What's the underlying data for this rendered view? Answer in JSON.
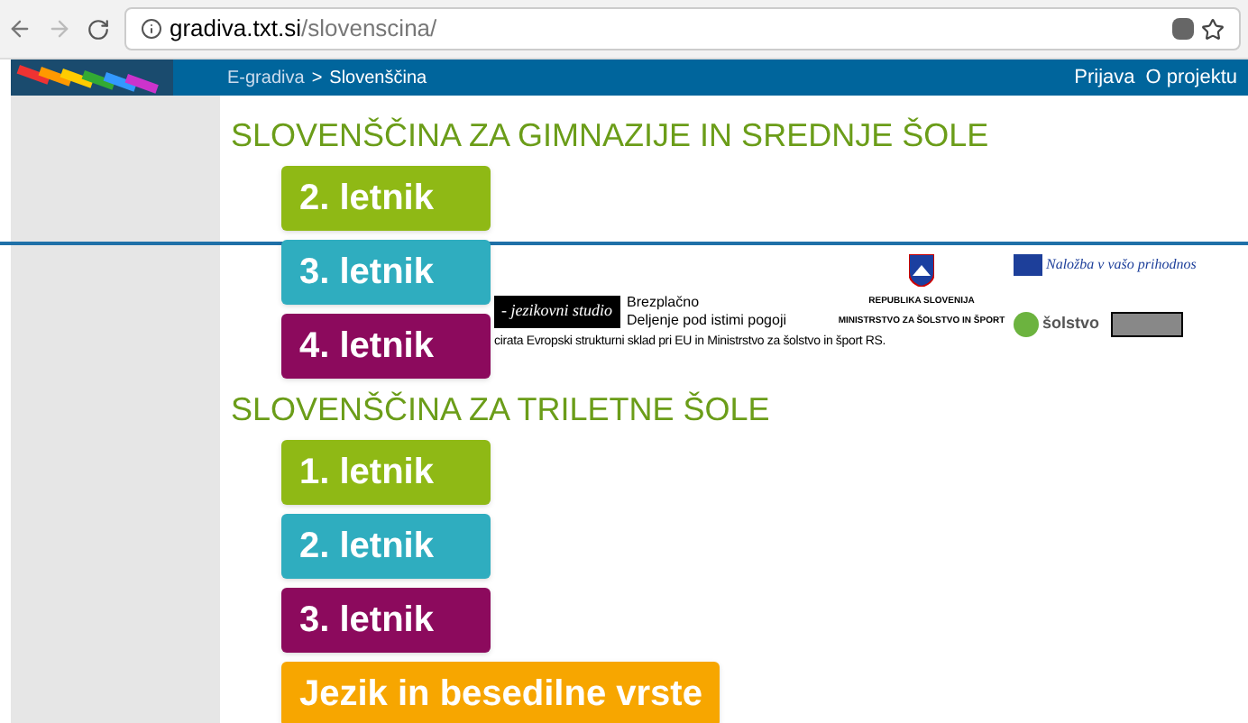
{
  "browser": {
    "url_host": "gradiva.txt.si",
    "url_path": "/slovenscina/"
  },
  "nav": {
    "breadcrumb": [
      {
        "label": "E-gradiva"
      },
      {
        "label": "Slovenščina"
      }
    ],
    "separator": ">",
    "links": [
      {
        "label": "Prijava"
      },
      {
        "label": "O projektu"
      }
    ]
  },
  "sections": [
    {
      "title": "SLOVENŠČINA ZA GIMNAZIJE IN SREDNJE ŠOLE",
      "buttons": [
        {
          "label": "2. letnik",
          "color": "#8fb915"
        },
        {
          "label": "3. letnik",
          "color": "#2fadbf"
        },
        {
          "label": "4. letnik",
          "color": "#8c0a5d"
        }
      ]
    },
    {
      "title": "SLOVENŠČINA ZA TRILETNE ŠOLE",
      "buttons": [
        {
          "label": "1. letnik",
          "color": "#8fb915"
        },
        {
          "label": "2. letnik",
          "color": "#2fadbf"
        },
        {
          "label": "3. letnik",
          "color": "#8c0a5d"
        },
        {
          "label": "Jezik in besedilne vrste",
          "color": "#f7a600"
        }
      ]
    }
  ],
  "footer": {
    "studio": "- jezikovni studio",
    "license": [
      "Brezplačno",
      "Deljenje pod istimi pogoji"
    ],
    "republic": "REPUBLIKA SLOVENIJA",
    "ministry": "MINISTRSTVO ZA ŠOLSTVO IN ŠPORT",
    "investment": "Naložba v vašo prihodnos",
    "esolstvo": "šolstvo",
    "funding": "cirata Evropski strukturni sklad pri EU in Ministrstvo za šolstvo in šport RS."
  }
}
